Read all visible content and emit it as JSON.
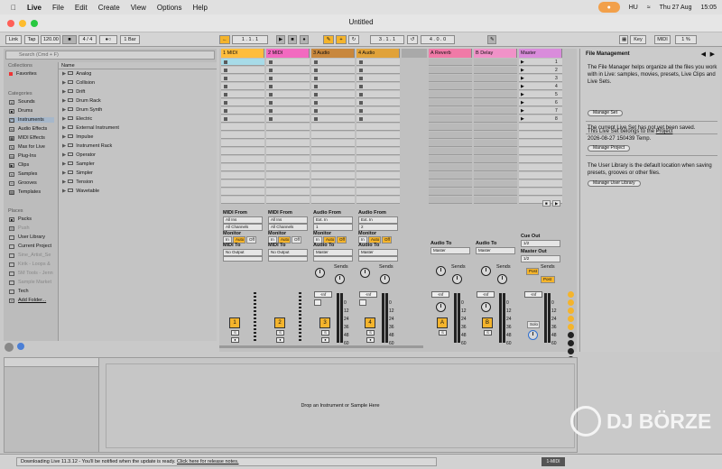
{
  "menubar": {
    "app": "Live",
    "items": [
      "File",
      "Edit",
      "Create",
      "View",
      "Options",
      "Help"
    ],
    "status": {
      "lang": "HU",
      "date": "Thu 27 Aug",
      "time": "15:05"
    }
  },
  "window": {
    "title": "Untitled"
  },
  "control": {
    "link": "Link",
    "tap": "Tap",
    "tempo": "120.00",
    "sig": "4 / 4",
    "quant": "1 Bar",
    "pos": "1 . 1 . 1",
    "loop_start": "3 . 1 . 1",
    "loop_len": "4 . 0 . 0",
    "key": "Key",
    "midi": "MIDI",
    "cpu": "1 %"
  },
  "browser": {
    "search": "Search (Cmd + F)",
    "collections_label": "Collections",
    "favorites": "Favorites",
    "categories_label": "Categories",
    "categories": [
      "Sounds",
      "Drums",
      "Instruments",
      "Audio Effects",
      "MIDI Effects",
      "Max for Live",
      "Plug-Ins",
      "Clips",
      "Samples",
      "Grooves",
      "Templates"
    ],
    "places_label": "Places",
    "places": [
      "Packs",
      "Push",
      "User Library",
      "Current Project",
      "Sine_Artist_Se",
      "Kirik - Loops &",
      "5M Tools - Jenn",
      "Sample Market",
      "Tech",
      "Add Folder..."
    ],
    "name_header": "Name",
    "items": [
      "Analog",
      "Collision",
      "Drift",
      "Drum Rack",
      "Drum Synth",
      "Electric",
      "External Instrument",
      "Impulse",
      "Instrument Rack",
      "Operator",
      "Sampler",
      "Simpler",
      "Tension",
      "Wavetable"
    ]
  },
  "tracks": [
    {
      "name": "1 MIDI",
      "color": "#ffbd3d",
      "num": "1",
      "type": "midi",
      "from_label": "MIDI From",
      "from": "All Ins",
      "chan": "All Channels",
      "to_label": "MIDI To",
      "to": "No Output"
    },
    {
      "name": "2 MIDI",
      "color": "#f26ac0",
      "num": "2",
      "type": "midi",
      "from_label": "MIDI From",
      "from": "All Ins",
      "chan": "All Channels",
      "to_label": "MIDI To",
      "to": "No Output"
    },
    {
      "name": "3 Audio",
      "color": "#c8873d",
      "num": "3",
      "type": "audio",
      "from_label": "Audio From",
      "from": "Ext. In",
      "chan": "1",
      "to_label": "Audio To",
      "to": "Master"
    },
    {
      "name": "4 Audio",
      "color": "#e0a23a",
      "num": "4",
      "type": "audio",
      "from_label": "Audio From",
      "from": "Ext. In",
      "chan": "2",
      "to_label": "Audio To",
      "to": "Master"
    }
  ],
  "returns": [
    {
      "name": "A Reverb",
      "color": "#f07aa7",
      "num": "A",
      "to_label": "Audio To",
      "to": "Master"
    },
    {
      "name": "B Delay",
      "color": "#f092c8",
      "num": "B",
      "to_label": "Audio To",
      "to": "Master"
    }
  ],
  "master": {
    "name": "Master",
    "color": "#d98cdb",
    "cue_label": "Cue Out",
    "cue": "1/2",
    "out_label": "Master Out",
    "out": "1/2",
    "solo": "Solo",
    "post": "Post"
  },
  "mixer": {
    "monitor": "Monitor",
    "in": "In",
    "auto": "Auto",
    "off": "Off",
    "sends": "Sends",
    "vol": "-Inf",
    "db": [
      "0",
      "12",
      "24",
      "36",
      "48",
      "60"
    ],
    "scenes": [
      "1",
      "2",
      "3",
      "4",
      "5",
      "6",
      "7",
      "8"
    ]
  },
  "info": {
    "title": "File Management",
    "p1": "The File Manager helps organize all the files you work with in Live: samples, movies, presets, Live Clips and Live Sets.",
    "b1": "Manage Set",
    "p2": "The current Live Set has not yet been saved.",
    "p3a": "This Live Set belongs to the",
    "p3link": "Project",
    "p3b": "2026-08-27 150439 Temp.",
    "b3": "Manage Project",
    "p4": "The User Library is the default location when saving presets, grooves or other files.",
    "b4": "Manage User Library"
  },
  "device": {
    "drop": "Drop an Instrument or Sample Here"
  },
  "status": {
    "msg": "Downloading Live 11.3.12 - You'll be notified when the update is ready.",
    "link": "Click here for release notes.",
    "track": "1-MIDI"
  },
  "watermark": {
    "text": "DJ BÖRZE"
  }
}
